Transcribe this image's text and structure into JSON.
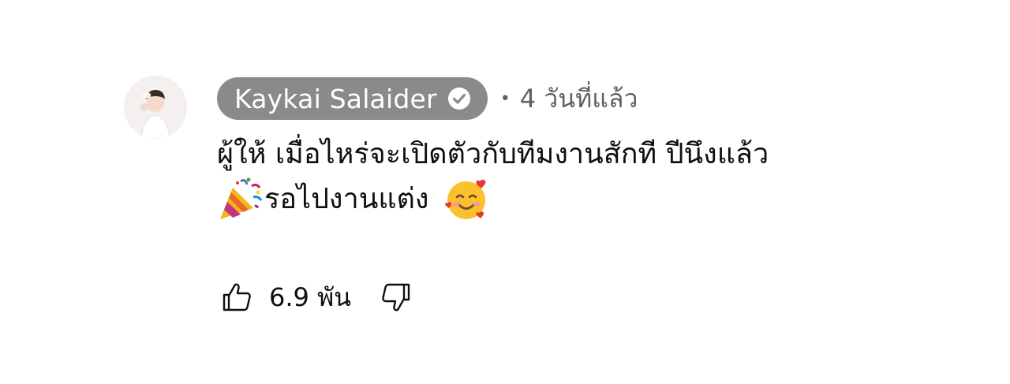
{
  "comment": {
    "author": "Kaykai Salaider",
    "verified": true,
    "separator": "•",
    "time": "4 วันที่แล้ว",
    "text_line1": "ผู้ให้ เมื่อไหร่จะเปิดตัวกับทีมงานสักที ปีนึงแล้ว",
    "text_line2": "รอไปงานแต่ง",
    "emoji_1": "party-popper-icon",
    "emoji_2": "smiling-face-with-hearts-icon",
    "likes": "6.9 พัน"
  },
  "colors": {
    "author_chip_bg": "#8a8a8a",
    "author_text": "#ffffff",
    "meta_text": "#606060",
    "body_text": "#0f0f0f"
  }
}
